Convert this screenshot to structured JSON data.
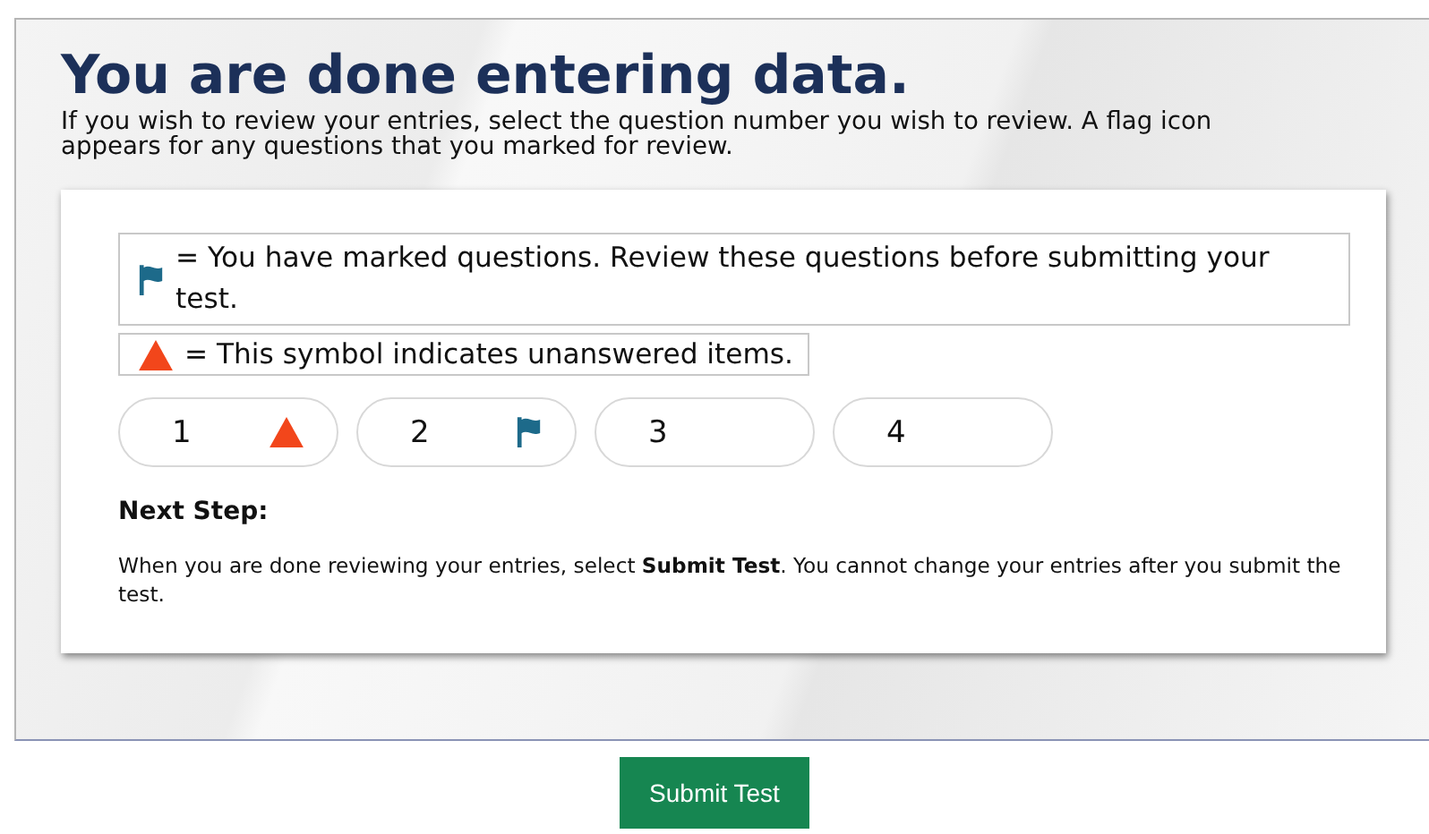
{
  "heading": "You are done entering data.",
  "intro": "If you wish to review your entries, select the question number you wish to review. A flag icon appears for any questions that you marked for review.",
  "legend": [
    {
      "kind": "marked",
      "text": "= You have marked questions. Review these questions before submitting your test."
    },
    {
      "kind": "unanswered",
      "text": "= This symbol indicates unanswered items."
    }
  ],
  "questions": [
    {
      "number": "1",
      "unanswered": true,
      "flagged": false
    },
    {
      "number": "2",
      "unanswered": false,
      "flagged": true
    },
    {
      "number": "3",
      "unanswered": false,
      "flagged": false
    },
    {
      "number": "4",
      "unanswered": false,
      "flagged": false
    }
  ],
  "next_step": {
    "title": "Next Step:",
    "text": "When you are done reviewing your entries, select **Submit Test**. You cannot change your entries after you submit the test."
  },
  "submit_button": "Submit Test"
}
